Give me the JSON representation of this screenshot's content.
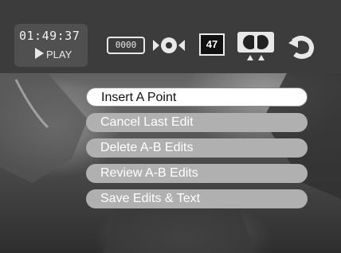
{
  "header": {
    "time": "01:49:37",
    "play_label": "PLAY"
  },
  "toolbar": {
    "counter_text": "0000",
    "chapter_number": "47",
    "icons": [
      "counter-icon",
      "a-b-marker-icon",
      "chapter-number-icon",
      "audio-icon",
      "back-icon"
    ]
  },
  "menu": {
    "items": [
      {
        "label": "Insert A Point",
        "selected": true
      },
      {
        "label": "Cancel Last Edit",
        "selected": false
      },
      {
        "label": "Delete A-B Edits",
        "selected": false
      },
      {
        "label": "Review A-B Edits",
        "selected": false
      },
      {
        "label": "Save Edits & Text",
        "selected": false
      }
    ]
  },
  "colors": {
    "selected_item_bg": "#ffffff",
    "item_bg": "#bdbdbd",
    "bar_bg": "#3c3c3c"
  }
}
